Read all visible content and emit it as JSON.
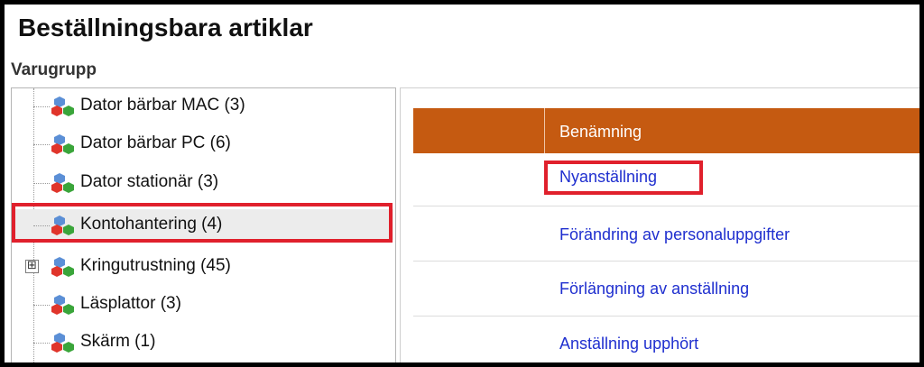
{
  "page": {
    "title": "Beställningsbara artiklar",
    "section_label": "Varugrupp"
  },
  "tree": {
    "items": [
      {
        "label": "Dator bärbar MAC (3)",
        "icon": "product-cubes-icon",
        "selected": false
      },
      {
        "label": "Dator bärbar PC (6)",
        "icon": "product-cubes-icon",
        "selected": false
      },
      {
        "label": "Dator stationär (3)",
        "icon": "product-cubes-icon",
        "selected": false
      },
      {
        "label": "Kontohantering (4)",
        "icon": "product-cubes-icon",
        "selected": true
      },
      {
        "label": "Kringutrustning (45)",
        "icon": "product-cubes-icon",
        "selected": false,
        "expander": "⊞"
      },
      {
        "label": "Läsplattor (3)",
        "icon": "product-cubes-icon",
        "selected": false
      },
      {
        "label": "Skärm (1)",
        "icon": "product-cubes-icon",
        "selected": false
      }
    ]
  },
  "grid": {
    "header": {
      "column_name": "Benämning"
    },
    "rows": [
      {
        "name": "Nyanställning"
      },
      {
        "name": "Förändring av personaluppgifter"
      },
      {
        "name": "Förlängning av anställning"
      },
      {
        "name": "Anställning upphört"
      }
    ]
  },
  "colors": {
    "header_bg": "#c55a11",
    "link": "#1f2fcf",
    "highlight": "#e0202c",
    "selected_bg": "#ececec"
  }
}
